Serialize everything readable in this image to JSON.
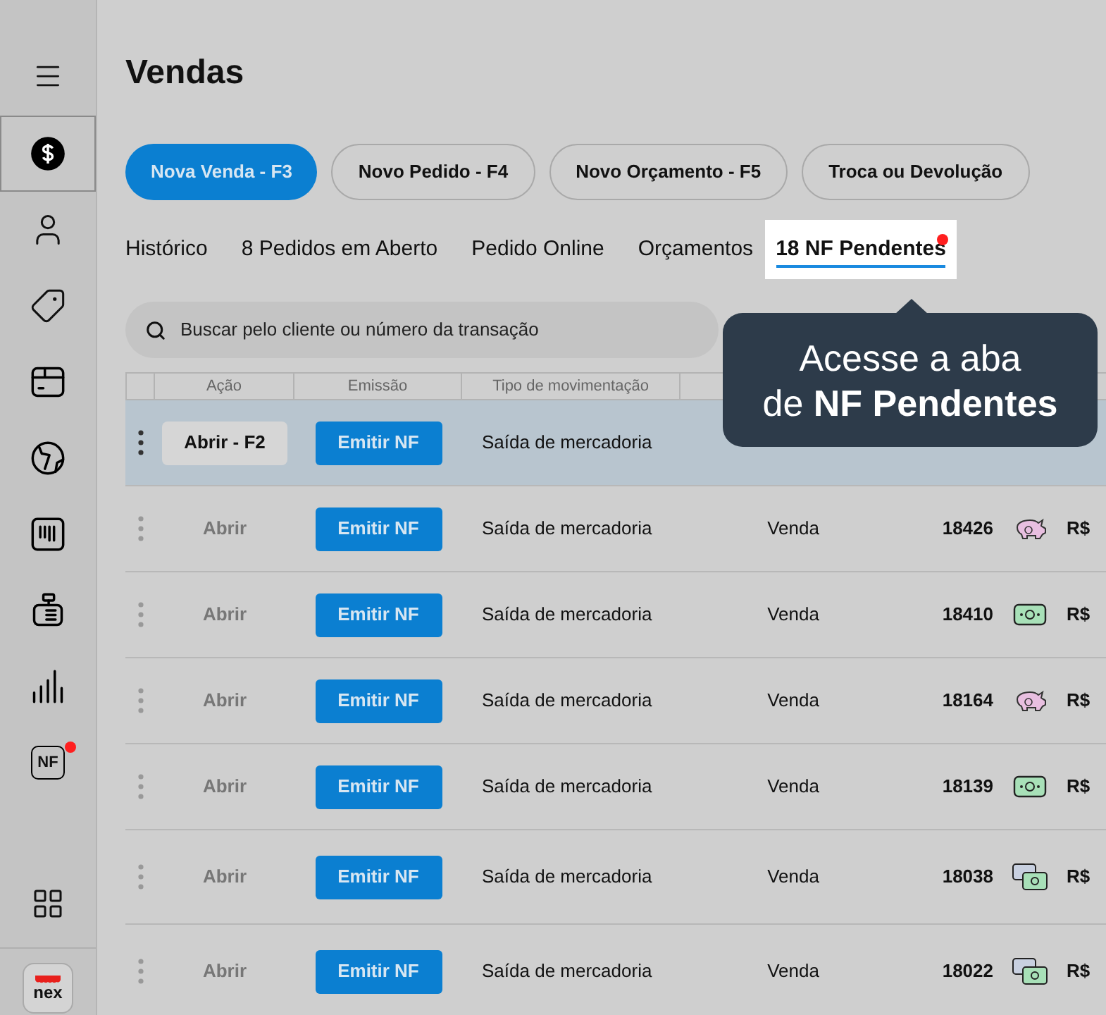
{
  "sidebar": {
    "items": [
      {
        "selected": false,
        "badge": false
      },
      {
        "selected": true,
        "badge": false
      },
      {
        "selected": false,
        "badge": false
      },
      {
        "selected": false,
        "badge": false
      },
      {
        "selected": false,
        "badge": false
      },
      {
        "selected": false,
        "badge": false
      },
      {
        "selected": false,
        "badge": false
      },
      {
        "selected": false,
        "badge": false
      },
      {
        "selected": false,
        "badge": false
      },
      {
        "selected": false,
        "badge": true,
        "label": "NF"
      },
      {
        "selected": false,
        "badge": false
      }
    ],
    "logo": "nex"
  },
  "title": "Vendas",
  "actions": [
    {
      "label": "Nova Venda - F3",
      "primary": true
    },
    {
      "label": "Novo Pedido - F4",
      "primary": false
    },
    {
      "label": "Novo Orçamento - F5",
      "primary": false
    },
    {
      "label": "Troca ou Devolução",
      "primary": false
    }
  ],
  "tabs": [
    {
      "label": "Histórico",
      "selected": false,
      "badge": false
    },
    {
      "label": "8 Pedidos em Aberto",
      "selected": false,
      "badge": false
    },
    {
      "label": "Pedido Online",
      "selected": false,
      "badge": false
    },
    {
      "label": "Orçamentos",
      "selected": false,
      "badge": false
    },
    {
      "label": "18 NF Pendentes",
      "selected": true,
      "badge": true
    }
  ],
  "search": {
    "placeholder": "Buscar pelo cliente ou número da transação"
  },
  "table": {
    "columns": [
      "Ação",
      "Emissão",
      "Tipo de movimentação"
    ],
    "rows": [
      {
        "selected": true,
        "action": "Abrir - F2",
        "emit": "Emitir NF",
        "movement": "Saída de mercadoria"
      },
      {
        "selected": false,
        "action": "Abrir",
        "emit": "Emitir NF",
        "movement": "Saída de mercadoria",
        "type": "Venda",
        "number": "18426",
        "kind": "piggy",
        "value": "R$"
      },
      {
        "selected": false,
        "action": "Abrir",
        "emit": "Emitir NF",
        "movement": "Saída de mercadoria",
        "type": "Venda",
        "number": "18410",
        "kind": "cash",
        "value": "R$"
      },
      {
        "selected": false,
        "action": "Abrir",
        "emit": "Emitir NF",
        "movement": "Saída de mercadoria",
        "type": "Venda",
        "number": "18164",
        "kind": "piggy",
        "value": "R$"
      },
      {
        "selected": false,
        "action": "Abrir",
        "emit": "Emitir NF",
        "movement": "Saída de mercadoria",
        "type": "Venda",
        "number": "18139",
        "kind": "cash",
        "value": "R$"
      },
      {
        "selected": false,
        "action": "Abrir",
        "emit": "Emitir NF",
        "movement": "Saída de mercadoria",
        "type": "Venda",
        "number": "18038",
        "kind": "cards",
        "value": "R$"
      },
      {
        "selected": false,
        "action": "Abrir",
        "emit": "Emitir NF",
        "movement": "Saída de mercadoria",
        "type": "Venda",
        "number": "18022",
        "kind": "cards",
        "value": "R$"
      }
    ]
  },
  "tooltip": {
    "lines": [
      "Acesse a aba",
      "de **NF Pendentes**"
    ]
  }
}
